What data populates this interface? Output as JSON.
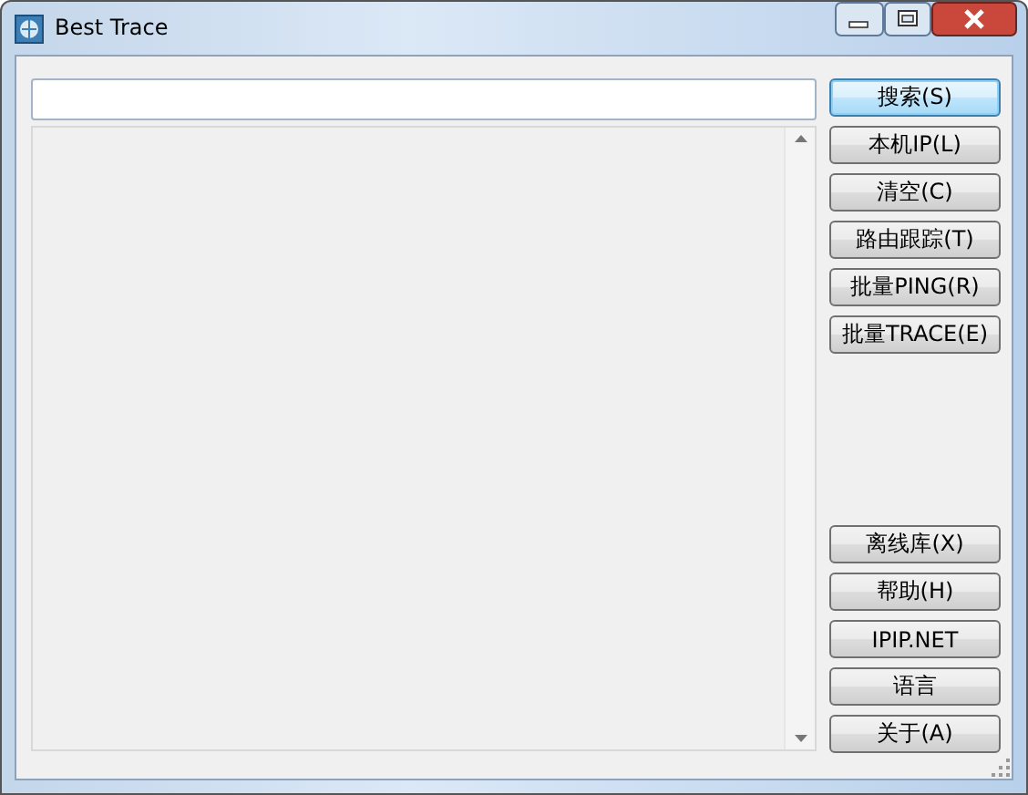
{
  "window": {
    "title": "Best Trace"
  },
  "buttons_top": [
    {
      "label": "搜索(S)",
      "default": true
    },
    {
      "label": "本机IP(L)",
      "default": false
    },
    {
      "label": "清空(C)",
      "default": false
    },
    {
      "label": "路由跟踪(T)",
      "default": false
    },
    {
      "label": "批量PING(R)",
      "default": false
    },
    {
      "label": "批量TRACE(E)",
      "default": false
    }
  ],
  "buttons_bottom": [
    {
      "label": "离线库(X)",
      "default": false
    },
    {
      "label": "帮助(H)",
      "default": false
    },
    {
      "label": "IPIP.NET",
      "default": false
    },
    {
      "label": "语言",
      "default": false
    },
    {
      "label": "关于(A)",
      "default": false
    }
  ]
}
